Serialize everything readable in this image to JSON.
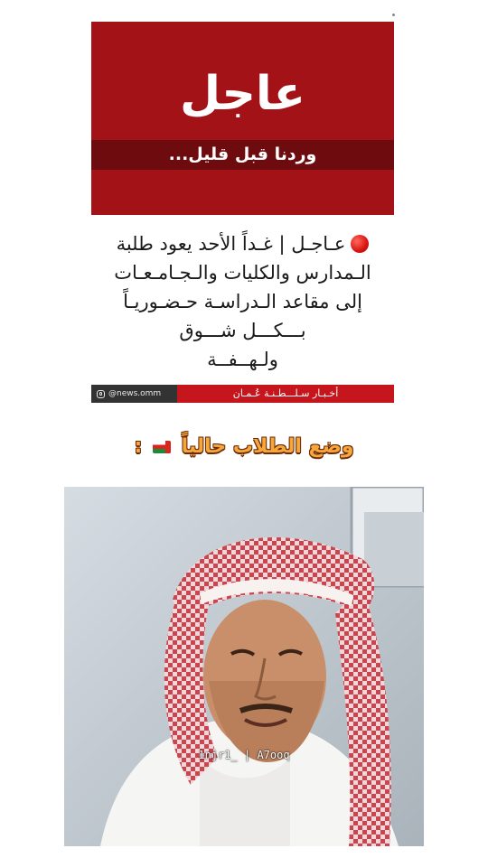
{
  "news_card": {
    "breaking_title": "عاجل",
    "breaking_subtitle": "وردنا قبل قليل...",
    "body_lines": [
      "عـاجـل | غـداً الأحد يعود طلبة",
      "الـمدارس والكليات والـجـامـعـات",
      "إلى مقاعد الـدراسـة حـضـوريـاً",
      "بـــكـــل شـــوق",
      "ولـهــفــة"
    ],
    "footer_handle": "@news.omm",
    "footer_source": "أخـبـار سـلـــطـنـة عُـمـان",
    "colors": {
      "banner": "#a31217",
      "strip": "#6e0b0f",
      "footer_red": "#c4161c"
    }
  },
  "caption": {
    "text": "وضع الطلاب حالياً",
    "suffix": ":",
    "flag_icon": "oman-flag-icon",
    "color": "#f6a63a"
  },
  "photo": {
    "watermark": "1njr1_ | A7ooq"
  }
}
